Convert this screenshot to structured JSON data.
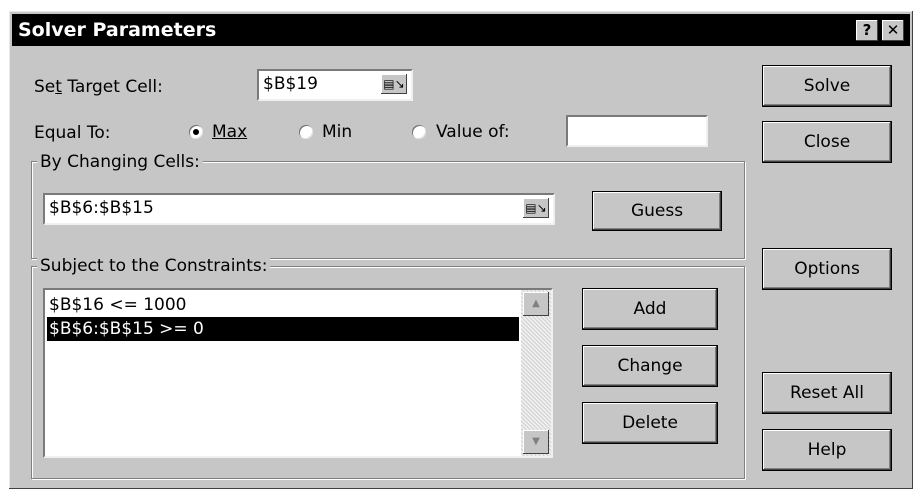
{
  "window": {
    "title": "Solver Parameters",
    "help_btn": "?",
    "close_btn": "✕"
  },
  "target": {
    "label_pre": "Se",
    "label_u": "t",
    "label_post": " Target Cell:",
    "value": "$B$19"
  },
  "equal_to": {
    "label": "Equal To:",
    "max": "Max",
    "min": "Min",
    "value_of": "Value of:",
    "value_of_input": "",
    "selected": "max"
  },
  "changing": {
    "title": "By Changing Cells:",
    "value": "$B$6:$B$15",
    "guess": "Guess"
  },
  "constraints": {
    "title": "Subject to the Constraints:",
    "items": [
      "$B$16 <= 1000",
      "$B$6:$B$15 >= 0"
    ],
    "selected_index": 1
  },
  "buttons": {
    "solve": "Solve",
    "close": "Close",
    "options": "Options",
    "add": "Add",
    "change": "Change",
    "delete": "Delete",
    "reset_all": "Reset All",
    "help": "Help"
  },
  "icons": {
    "refedit": "range-select-icon",
    "scroll_up": "scroll-up-arrow-icon",
    "scroll_down": "scroll-down-arrow-icon"
  },
  "colors": {
    "dialog_bg": "#c6c6c6",
    "titlebar_bg": "#000000",
    "selection_bg": "#000000"
  }
}
